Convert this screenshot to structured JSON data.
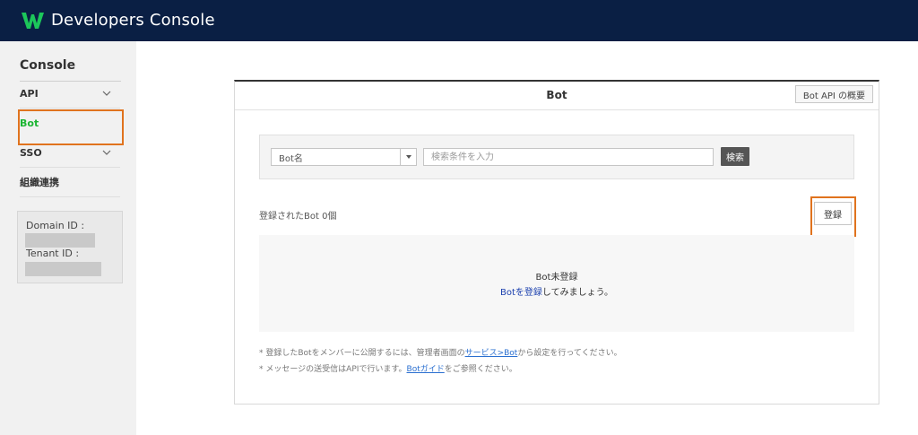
{
  "header": {
    "title": "Developers Console",
    "brand_color": "#0a1f44",
    "logo_color": "#1cc65a"
  },
  "sidebar": {
    "heading": "Console",
    "items": [
      {
        "label": "API",
        "has_chevron": true
      },
      {
        "label": "Bot",
        "active": true
      },
      {
        "label": "SSO",
        "has_chevron": true
      },
      {
        "label": "組織連携"
      }
    ],
    "ids": {
      "domain_label": "Domain ID :",
      "tenant_label": "Tenant ID :"
    }
  },
  "panel": {
    "title": "Bot",
    "api_overview_label": "Bot API の概要",
    "search": {
      "select_value": "Bot名",
      "input_placeholder": "検索条件を入力",
      "button_label": "検索"
    },
    "count_text": "登録されたBot 0個",
    "register_label": "登録",
    "empty": {
      "title": "Bot未登録",
      "link_text": "Botを登録",
      "suffix": "してみましょう。"
    },
    "notes": [
      {
        "prefix": "* 登録したBotをメンバーに公開するには、管理者画面の",
        "link": "サービス>Bot",
        "suffix": "から設定を行ってください。"
      },
      {
        "prefix": "* メッセージの送受信はAPIで行います。",
        "link": "Botガイド",
        "suffix": "をご参照ください。"
      }
    ]
  },
  "highlight_color": "#e0731e"
}
